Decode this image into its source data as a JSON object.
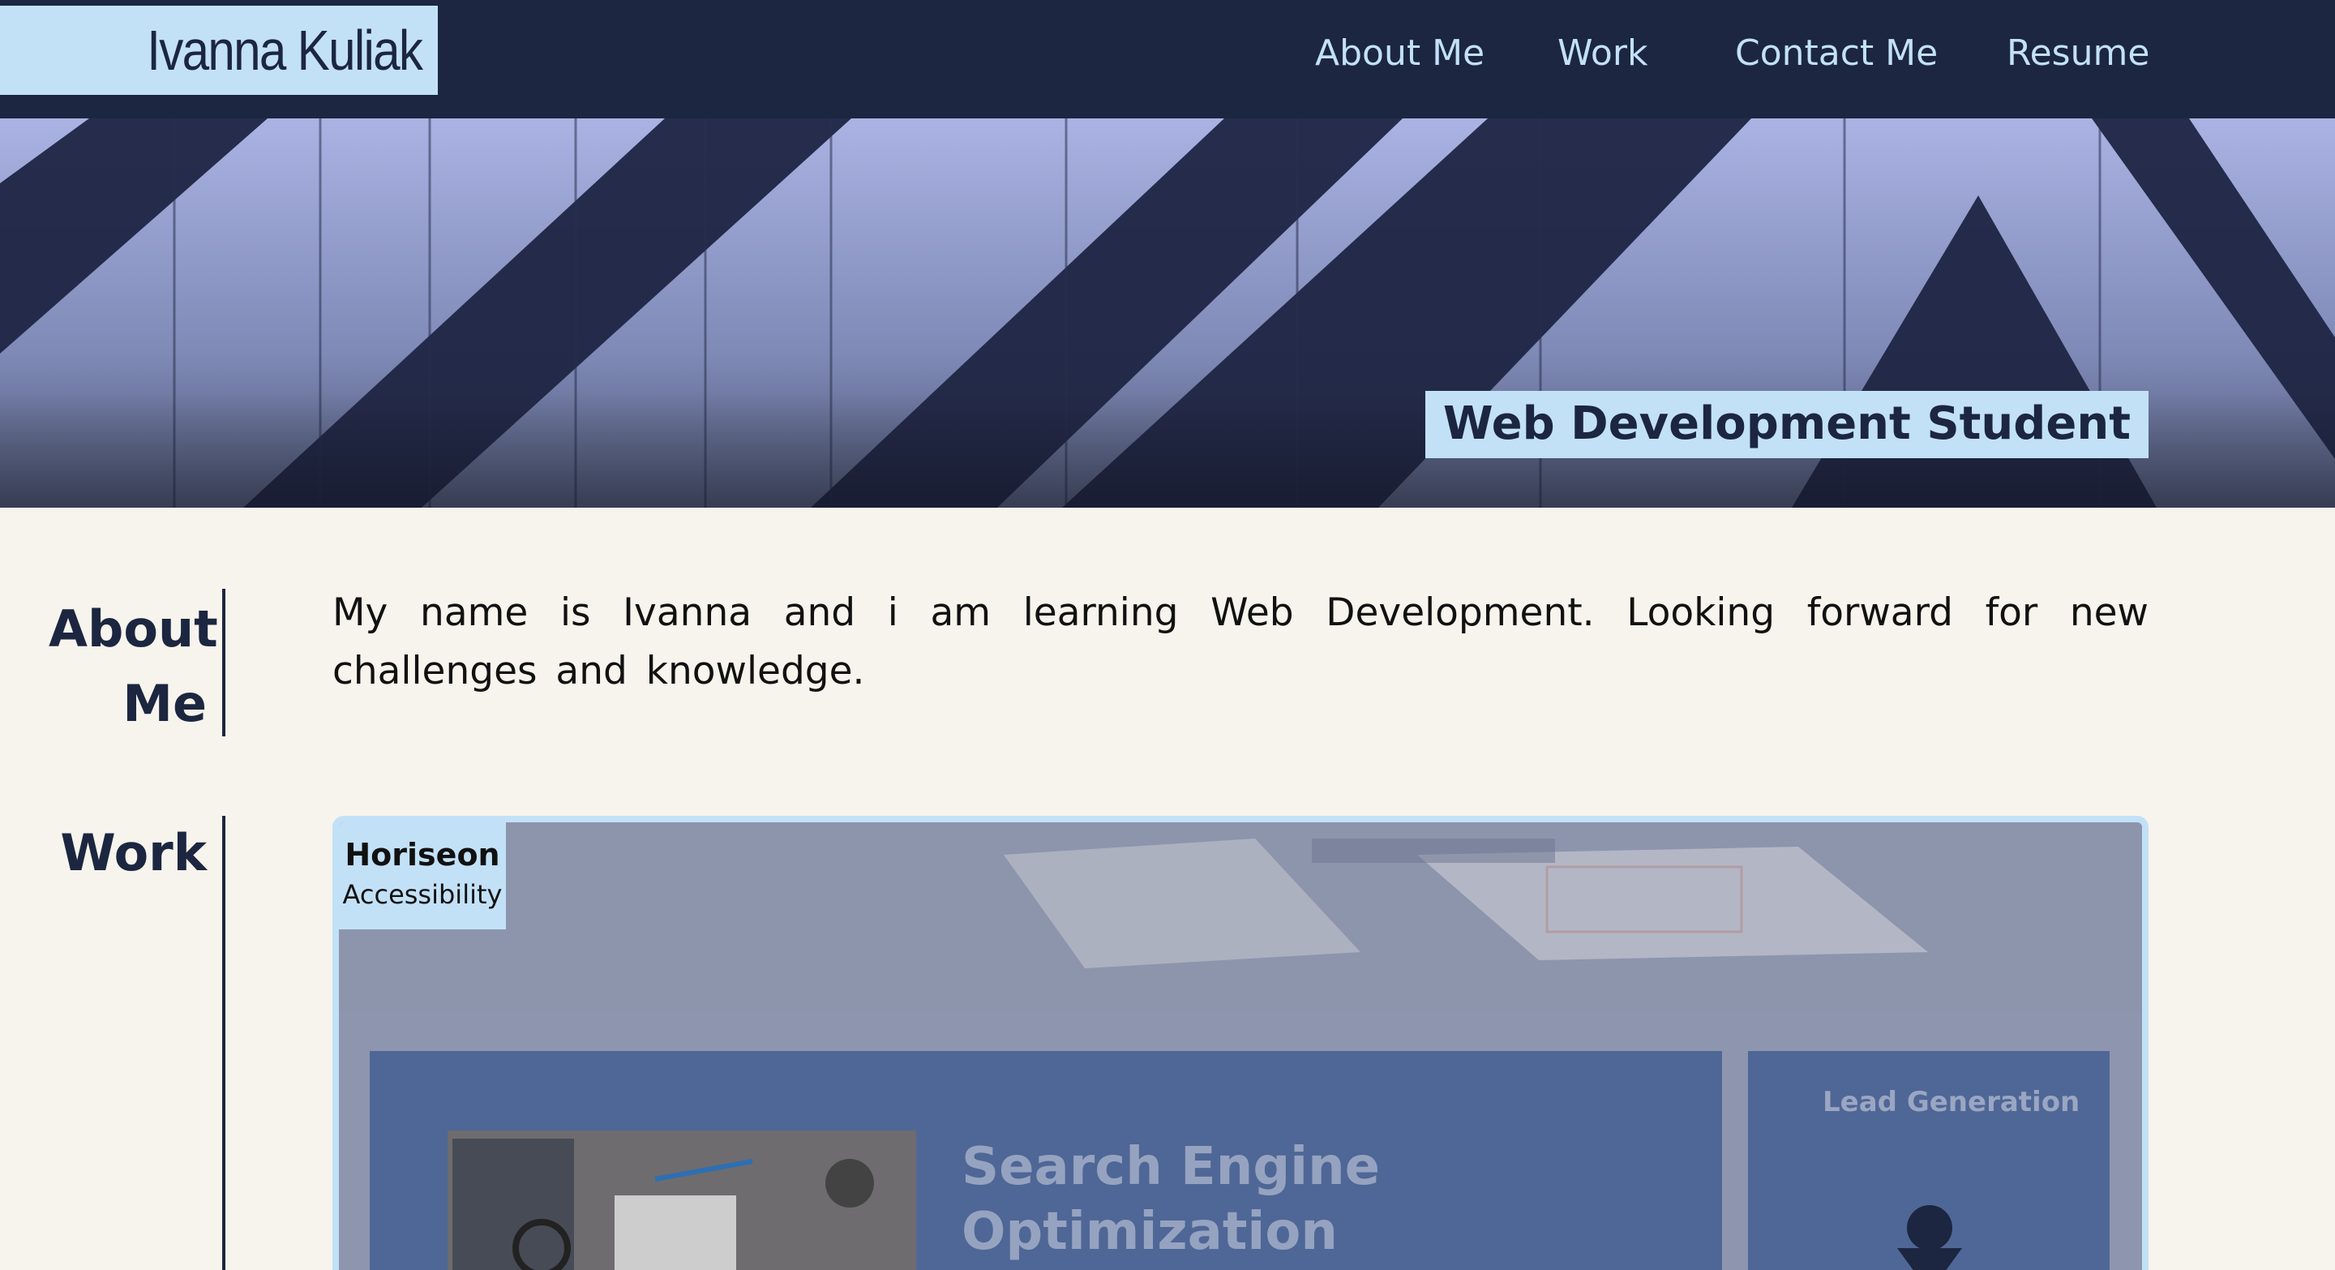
{
  "header": {
    "brand": "Ivanna Kuliak",
    "nav": [
      {
        "label": "About Me"
      },
      {
        "label": "Work"
      },
      {
        "label": "Contact Me"
      },
      {
        "label": "Resume"
      }
    ]
  },
  "hero": {
    "subtitle": "Web Development Student"
  },
  "about": {
    "heading_line1": "About",
    "heading_line2": "Me",
    "body": "My name is Ivanna and i am learning Web Development. Looking forward for new challenges and knowledge."
  },
  "work": {
    "heading": "Work",
    "projects": [
      {
        "title": "Horiseon",
        "subtitle": "Accessibility",
        "screenshot_text": {
          "seo_line1": "Search Engine",
          "seo_line2": "Optimization",
          "lead": "Lead Generation"
        }
      }
    ]
  },
  "colors": {
    "navy": "#1c2640",
    "light_blue": "#c2e1f7",
    "cream": "#f6f4ec"
  }
}
